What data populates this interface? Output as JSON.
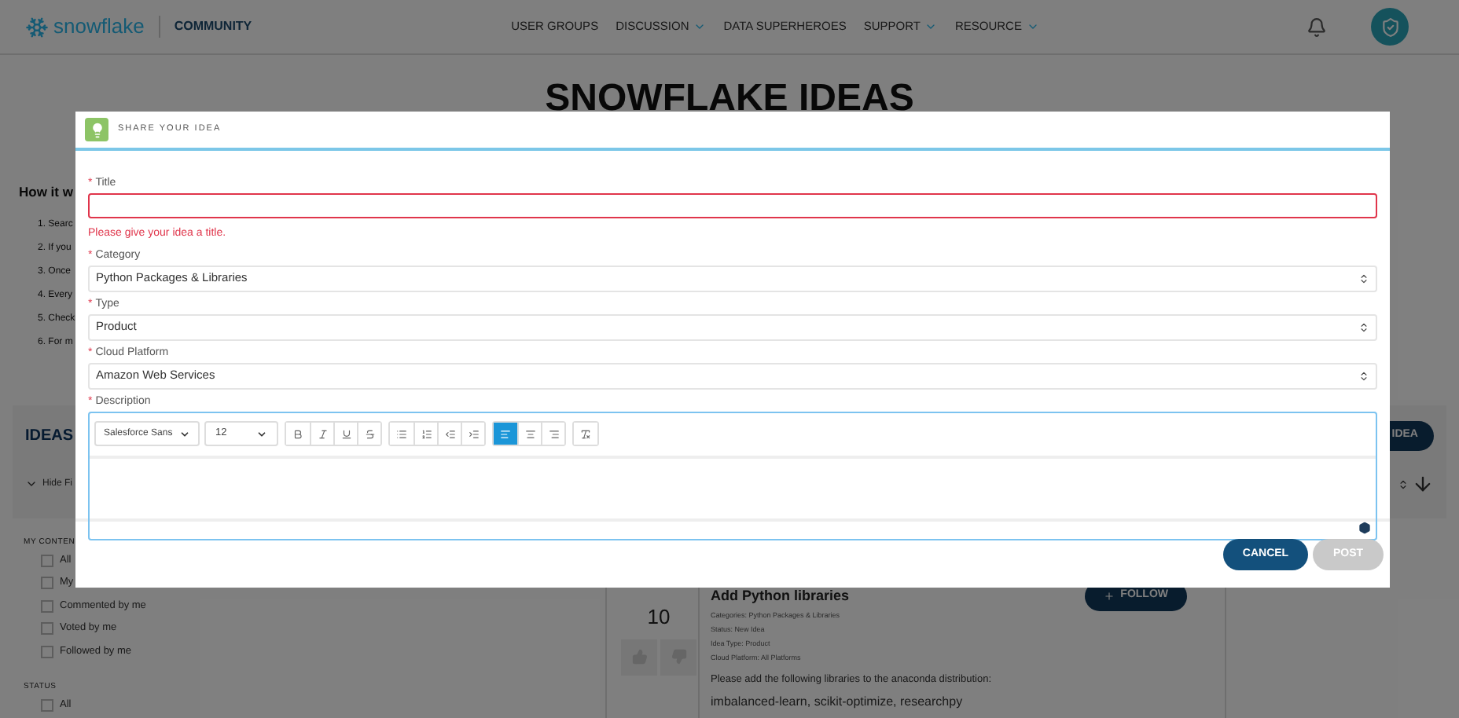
{
  "header": {
    "logo": "snowflake",
    "community": "COMMUNITY",
    "nav": [
      {
        "label": "USER GROUPS",
        "has_menu": false
      },
      {
        "label": "DISCUSSION",
        "has_menu": true
      },
      {
        "label": "DATA SUPERHEROES",
        "has_menu": false
      },
      {
        "label": "SUPPORT",
        "has_menu": true
      },
      {
        "label": "RESOURCE",
        "has_menu": true
      }
    ]
  },
  "page": {
    "title": "SNOWFLAKE IDEAS",
    "how_title": "How it w",
    "how_steps": [
      "1. Searc",
      "2. If you",
      "3. Once",
      "4. Every",
      "5. Check",
      "6. For m"
    ]
  },
  "ideas_panel": {
    "title": "IDEAS",
    "new_button": "IDEA",
    "filter_toggle": "Hide Fi"
  },
  "filters": [
    {
      "heading": "MY CONTEN",
      "items": [
        {
          "label": "All",
          "checked": false
        },
        {
          "label": "My",
          "checked": false
        },
        {
          "label": "Commented by me",
          "checked": false
        },
        {
          "label": "Voted by me",
          "checked": false
        },
        {
          "label": "Followed by me",
          "checked": false
        }
      ]
    },
    {
      "heading": "STATUS",
      "items": [
        {
          "label": "All",
          "checked": false
        }
      ]
    }
  ],
  "idea": {
    "votes": "10",
    "title": "Add Python libraries",
    "meta": [
      "Categories: Python Packages & Libraries",
      "Status: New Idea",
      "Idea Type: Product",
      "Cloud Platform: All Platforms"
    ],
    "follow": "FOLLOW",
    "body": [
      "Please add the following libraries to the anaconda distribution:",
      "imbalanced-learn, scikit-optimize, researchpy"
    ]
  },
  "modal": {
    "title": "SHARE YOUR IDEA",
    "fields": [
      {
        "kind": "text",
        "label": "Title",
        "required_mark": "*",
        "invalid": true,
        "error": "Please give your idea a title."
      },
      {
        "kind": "select",
        "label": "Category",
        "required_mark": "*",
        "value": "Python Packages & Libraries"
      },
      {
        "kind": "select",
        "label": "Type",
        "required_mark": "*",
        "value": "Product"
      },
      {
        "kind": "select",
        "label": "Cloud Platform",
        "required_mark": "*",
        "value": "Amazon Web Services"
      },
      {
        "kind": "editor",
        "label": "Description",
        "required_mark": "*"
      }
    ],
    "toolbar": {
      "font": "Salesforce Sans",
      "size": "12",
      "groups": [
        [
          {
            "kind": "bold",
            "selected": false
          },
          {
            "kind": "italic",
            "selected": false
          },
          {
            "kind": "underline",
            "selected": false
          },
          {
            "kind": "strike",
            "selected": false
          }
        ],
        [
          {
            "kind": "bullets",
            "selected": false
          },
          {
            "kind": "numbered",
            "selected": false
          },
          {
            "kind": "outdent",
            "selected": false
          },
          {
            "kind": "indent",
            "selected": false
          }
        ],
        [
          {
            "kind": "align-left",
            "selected": true
          },
          {
            "kind": "align-center",
            "selected": false
          },
          {
            "kind": "align-right",
            "selected": false
          }
        ],
        [
          {
            "kind": "clear-format",
            "selected": false
          }
        ]
      ]
    },
    "buttons": [
      {
        "label": "CANCEL",
        "disabled": false
      },
      {
        "label": "POST",
        "disabled": true
      }
    ]
  }
}
